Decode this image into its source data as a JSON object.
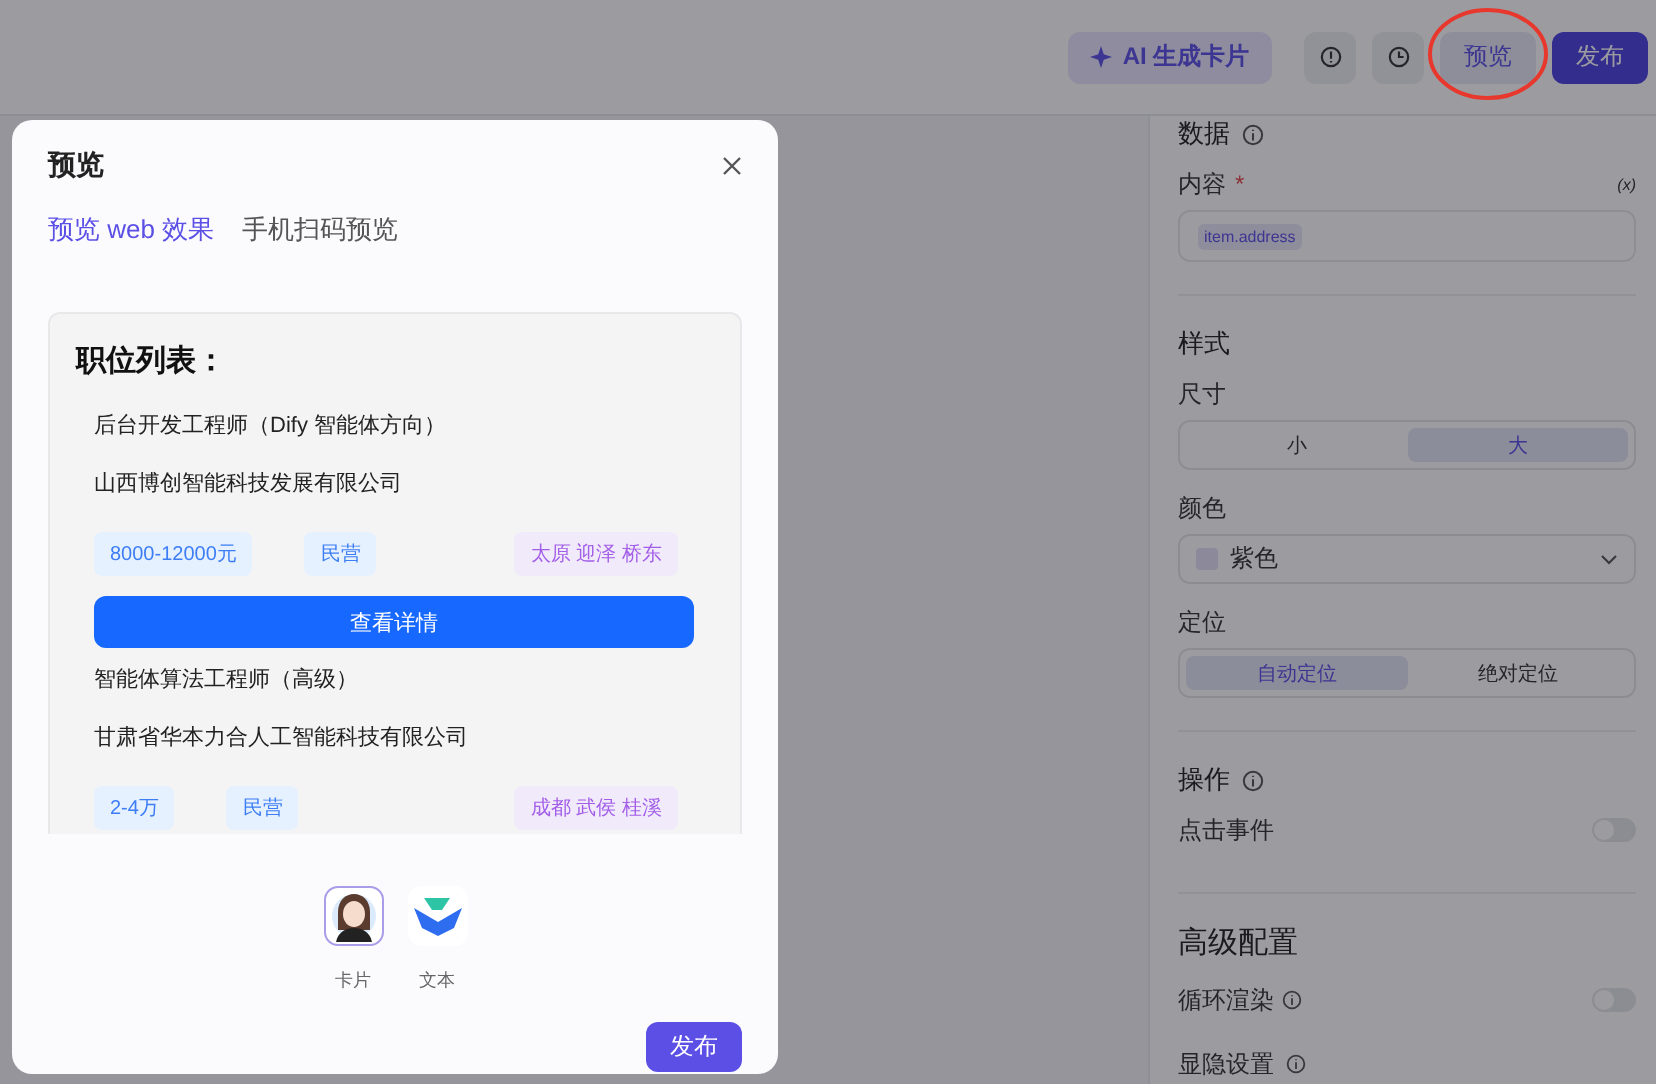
{
  "header": {
    "buttons": [
      {
        "kind": "ai",
        "label": "AI 生成卡片"
      },
      {
        "kind": "info"
      },
      {
        "kind": "history"
      },
      {
        "kind": "preview",
        "label": "预览"
      },
      {
        "kind": "publish",
        "label": "发布"
      }
    ]
  },
  "panel": {
    "data_section": {
      "title": "数据",
      "field_label": "内容",
      "required_mark": "*",
      "variable_mark": "(x)",
      "value_tag": "item.address"
    },
    "style_section": {
      "title": "样式",
      "size_label": "尺寸",
      "sizes": [
        {
          "label": "小",
          "selected": false
        },
        {
          "label": "大",
          "selected": true
        }
      ],
      "color_label": "颜色",
      "color_value": "紫色",
      "position_label": "定位",
      "positions": [
        {
          "label": "自动定位",
          "selected": true
        },
        {
          "label": "绝对定位",
          "selected": false
        }
      ]
    },
    "action_section": {
      "title": "操作",
      "toggles": [
        {
          "label": "点击事件",
          "on": false
        }
      ]
    },
    "advanced_section": {
      "title": "高级配置",
      "toggles": [
        {
          "label": "循环渲染",
          "on": false
        }
      ],
      "visibility_label": "显隐设置"
    }
  },
  "dialog": {
    "title": "预览",
    "tabs": [
      {
        "label": "预览 web 效果",
        "selected": true
      },
      {
        "label": "手机扫码预览",
        "selected": false
      }
    ],
    "preview": {
      "heading": "职位列表：",
      "jobs": [
        {
          "title": "后台开发工程师（Dify 智能体方向）",
          "company": "山西博创智能科技发展有限公司",
          "tags": [
            {
              "text": "8000-12000元",
              "kind": "info"
            },
            {
              "text": "民营",
              "kind": "info"
            },
            {
              "text": "太原 迎泽 桥东",
              "kind": "place"
            }
          ],
          "button": "查看详情"
        },
        {
          "title": "智能体算法工程师（高级）",
          "company": "甘肃省华本力合人工智能科技有限公司",
          "tags": [
            {
              "text": "2-4万",
              "kind": "info"
            },
            {
              "text": "民营",
              "kind": "info"
            },
            {
              "text": "成都 武侯 桂溪",
              "kind": "place"
            }
          ]
        }
      ]
    },
    "modes": [
      {
        "kind": "card",
        "label": "卡片",
        "selected": true
      },
      {
        "kind": "text",
        "label": "文本",
        "selected": false
      }
    ],
    "publish": "发布"
  }
}
